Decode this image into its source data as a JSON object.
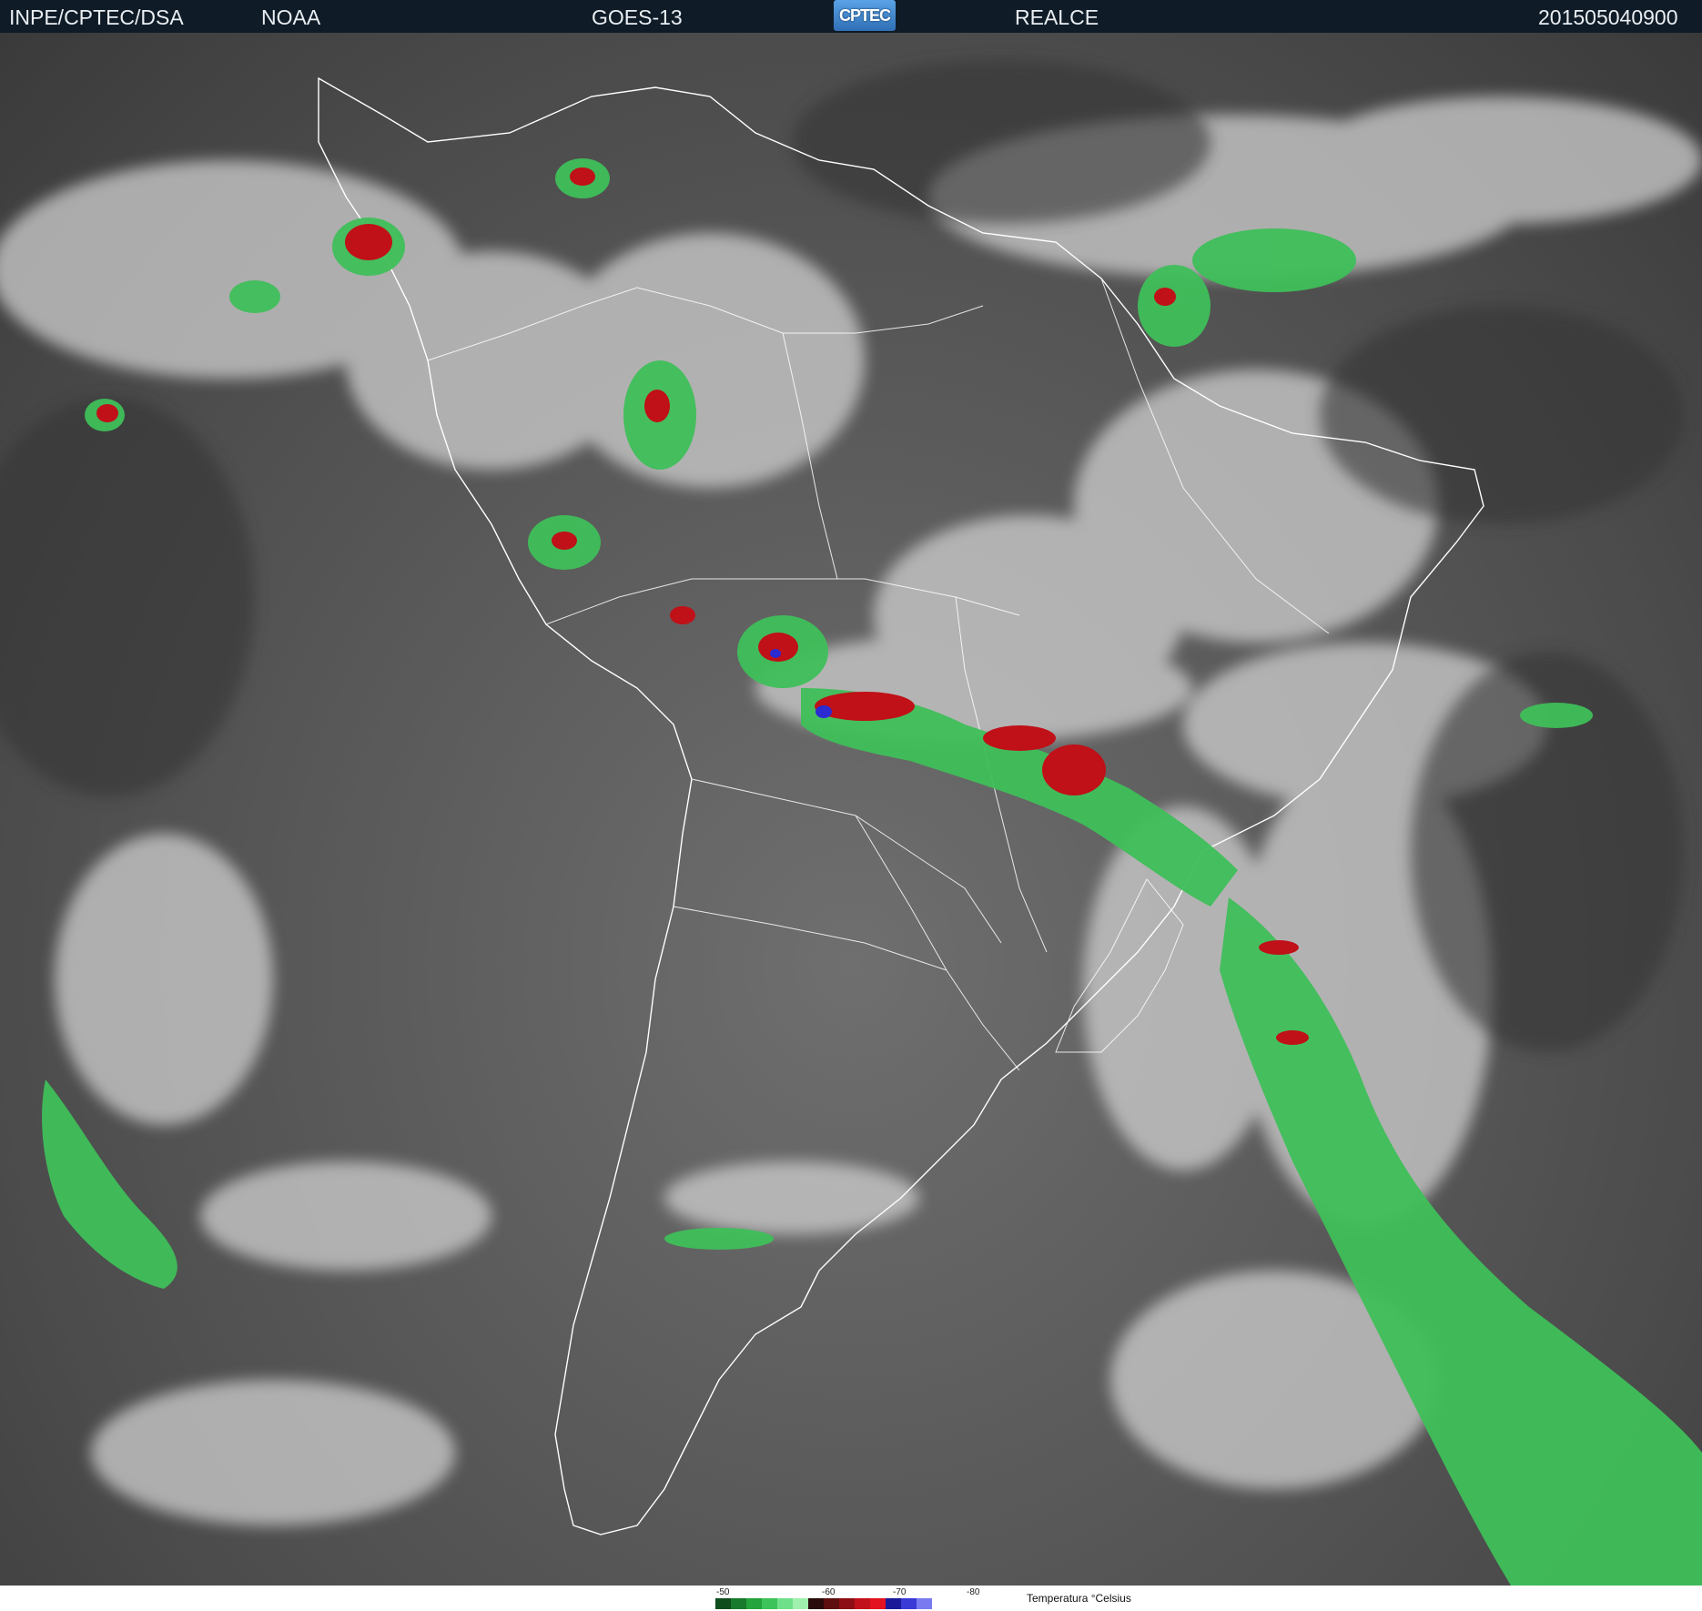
{
  "header": {
    "left_label": "INPE/CPTEC/DSA",
    "agency_label": "NOAA",
    "satellite_label": "GOES-13",
    "logo_text": "CPTEC",
    "product_label": "REALCE",
    "timestamp": "201505040900"
  },
  "legend": {
    "title": "Temperatura °Celsius",
    "ticks": [
      "-50",
      "-60",
      "-70",
      "-80"
    ],
    "colors": [
      "#0f4d1d",
      "#177a2c",
      "#24a43c",
      "#3cc35a",
      "#6fe08a",
      "#9ff0ae",
      "#2a0b0b",
      "#5e0e0e",
      "#8d0e14",
      "#c1121c",
      "#e3131f",
      "#1a1a99",
      "#3a3ad6",
      "#7a7af0"
    ]
  },
  "map": {
    "background": "#555555",
    "cloud_color": "#d9d9d9",
    "coastline_color": "#ffffff",
    "cold_cloud_green": "#3fbf5a",
    "cold_cloud_red": "#c01018",
    "cold_cloud_blue": "#2b2bd1"
  }
}
